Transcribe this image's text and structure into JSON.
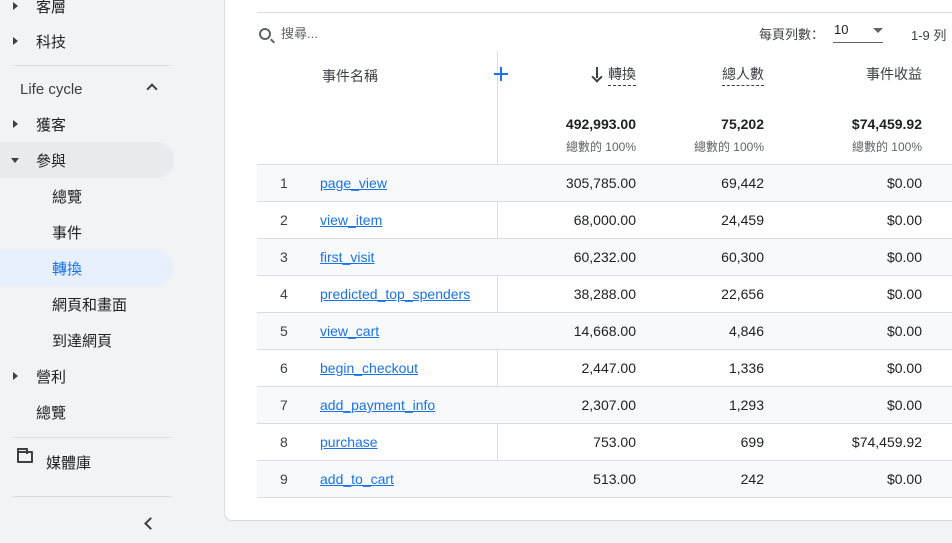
{
  "sidebar": {
    "items": [
      {
        "label": "客層",
        "caret": "right"
      },
      {
        "label": "科技",
        "caret": "right"
      },
      {
        "section": "Life cycle"
      },
      {
        "label": "獲客",
        "caret": "right"
      },
      {
        "label": "參與",
        "caret": "down"
      },
      {
        "label": "總覽",
        "sub": true
      },
      {
        "label": "事件",
        "sub": true
      },
      {
        "label": "轉換",
        "sub": true,
        "active": true
      },
      {
        "label": "網頁和畫面",
        "sub": true
      },
      {
        "label": "到達網頁",
        "sub": true
      },
      {
        "label": "營利",
        "caret": "right"
      },
      {
        "label": "總覽"
      }
    ],
    "section_label": "Life cycle",
    "library_label": "媒體庫"
  },
  "toolbar": {
    "search_placeholder": "搜尋...",
    "rows_per_page_label": "每頁列數：",
    "rows_per_page_value": "10",
    "range_label": "1-9 列"
  },
  "table": {
    "headers": {
      "event_name": "事件名稱",
      "conversions": "轉換",
      "total_users": "總人數",
      "event_revenue": "事件收益"
    },
    "totals": {
      "conversions": "492,993.00",
      "conversions_pct": "總數的 100%",
      "total_users": "75,202",
      "total_users_pct": "總數的 100%",
      "event_revenue": "$74,459.92",
      "event_revenue_pct": "總數的 100%"
    },
    "rows": [
      {
        "idx": "1",
        "name": "page_view",
        "conversions": "305,785.00",
        "users": "69,442",
        "revenue": "$0.00"
      },
      {
        "idx": "2",
        "name": "view_item",
        "conversions": "68,000.00",
        "users": "24,459",
        "revenue": "$0.00"
      },
      {
        "idx": "3",
        "name": "first_visit",
        "conversions": "60,232.00",
        "users": "60,300",
        "revenue": "$0.00"
      },
      {
        "idx": "4",
        "name": "predicted_top_spenders",
        "conversions": "38,288.00",
        "users": "22,656",
        "revenue": "$0.00"
      },
      {
        "idx": "5",
        "name": "view_cart",
        "conversions": "14,668.00",
        "users": "4,846",
        "revenue": "$0.00"
      },
      {
        "idx": "6",
        "name": "begin_checkout",
        "conversions": "2,447.00",
        "users": "1,336",
        "revenue": "$0.00"
      },
      {
        "idx": "7",
        "name": "add_payment_info",
        "conversions": "2,307.00",
        "users": "1,293",
        "revenue": "$0.00"
      },
      {
        "idx": "8",
        "name": "purchase",
        "conversions": "753.00",
        "users": "699",
        "revenue": "$74,459.92"
      },
      {
        "idx": "9",
        "name": "add_to_cart",
        "conversions": "513.00",
        "users": "242",
        "revenue": "$0.00"
      }
    ]
  },
  "colors": {
    "accent": "#1a73e8",
    "active_bg": "#e8f0fe",
    "selected_bg": "#e8eaed"
  }
}
